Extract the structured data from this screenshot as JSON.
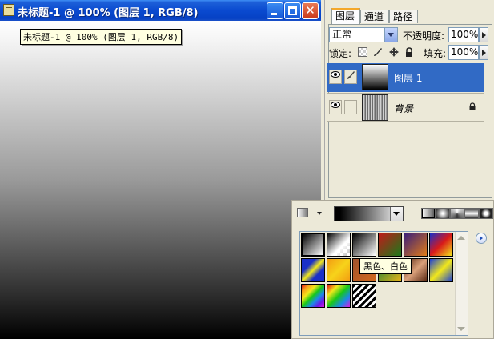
{
  "document": {
    "title": "未标题-1 @ 100% (图层 1, RGB/8)",
    "tooltip": "未标题-1 @ 100% (图层 1, RGB/8)",
    "buttons": {
      "minimize": "minimize",
      "maximize": "maximize",
      "close": "✕"
    }
  },
  "layers_panel": {
    "tabs": [
      "图层",
      "通道",
      "路径"
    ],
    "active_tab": "图层",
    "blend_mode": "正常",
    "opacity_label": "不透明度:",
    "opacity_value": "100%",
    "lock_label": "锁定:",
    "fill_label": "填充:",
    "fill_value": "100%",
    "icons": {
      "lock_transparent": "checker-icon",
      "lock_image": "brush-icon",
      "lock_position": "move-icon",
      "lock_all": "padlock-icon"
    },
    "layers": [
      {
        "name": "图层 1",
        "selected": true,
        "visible": true
      },
      {
        "name": "背景",
        "selected": false,
        "visible": true,
        "locked": true
      }
    ]
  },
  "gradient_panel": {
    "modes": [
      "linear",
      "radial",
      "angle",
      "reflected",
      "diamond"
    ],
    "active_mode": "linear",
    "swatch_tooltip": "黑色、白色",
    "swatch_count": 15
  },
  "colors": {
    "title_blue": "#0a4ad0",
    "selection_blue": "#316ac5",
    "panel_bg": "#ece9d8"
  }
}
